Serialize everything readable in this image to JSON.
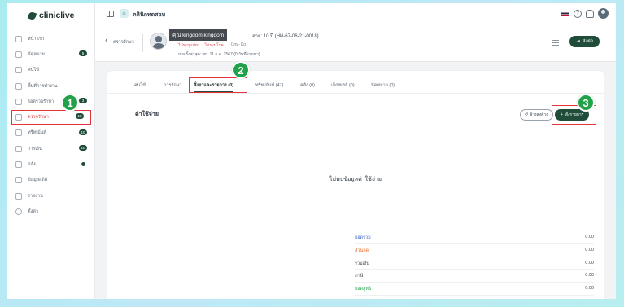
{
  "app": {
    "logo_text": "cliniclive",
    "clinic_name": "คลินิกทดสอบ",
    "accent_color": "#1f4d3a",
    "highlight_color": "#e5343b",
    "marker_color": "#21a24a"
  },
  "sidebar": {
    "items": [
      {
        "label": "หน้าแรก",
        "icon": "home-icon",
        "badge": ""
      },
      {
        "label": "นัดหมาย",
        "icon": "calendar-icon",
        "badge": "5"
      },
      {
        "label": "คนไข้",
        "icon": "patients-icon",
        "badge": ""
      },
      {
        "label": "พื้นที่การทำงาน",
        "icon": "workspace-icon",
        "badge": ""
      },
      {
        "label": "รอตรวจรักษา",
        "icon": "queue-icon",
        "badge": "3"
      },
      {
        "label": "ตรวจรักษา",
        "icon": "stethoscope-icon",
        "badge": "12"
      },
      {
        "label": "ทรีทเม้นท์",
        "icon": "treatment-icon",
        "badge": "10"
      },
      {
        "label": "การเงิน",
        "icon": "finance-icon",
        "badge": "10"
      },
      {
        "label": "คลัง",
        "icon": "inventory-icon",
        "badge": "dot"
      },
      {
        "label": "ข้อมูลสถิติ",
        "icon": "stats-icon",
        "badge": ""
      },
      {
        "label": "รายงาน",
        "icon": "report-icon",
        "badge": ""
      },
      {
        "label": "ตั้งค่า",
        "icon": "settings-icon",
        "badge": ""
      }
    ]
  },
  "patient": {
    "back_label": "ตรวจรักษา",
    "name": "คุณ kingdom kingdom",
    "meta": "อายุ: 10 ปี (HN-67-06-21-0018)",
    "warning_1": "ไม่ระบุแพ้ยา",
    "warning_2": "ไม่ระบุโรค",
    "vitals": "- Cm/- Kg",
    "last_visit": "มาครั้งล่าสุด: พฤ. 11 ก.ค. 2567 (0 วันที่ผ่านมา)",
    "action_button": "ส่งต่อ"
  },
  "tabs": [
    "คนไข้",
    "การรักษา",
    "สั่งยาและรายการ (0)",
    "ทรีทเม้นท์ (47)",
    "คลัง (0)",
    "เอ็กซเรย์ (0)",
    "นัดหมาย (0)"
  ],
  "content": {
    "section_title": "ค่าใช้จ่าย",
    "history_button": "ล้างลงค้าง",
    "order_button": "สั่งรายการ",
    "empty_message": "ไม่พบข้อมูลค่าใช้จ่าย"
  },
  "summary": [
    {
      "label": "ยอดรวม",
      "value": "0.00",
      "color": "#3f66c7"
    },
    {
      "label": "ส่วนลด",
      "value": "0.00",
      "color": "#ef6c2f"
    },
    {
      "label": "รวมเงิน",
      "value": "0.00",
      "color": "#3d4650"
    },
    {
      "label": "ภาษี",
      "value": "0.00",
      "color": "#3d4650"
    },
    {
      "label": "ยอดสุทธิ",
      "value": "0.00",
      "color": "#2fa84f"
    }
  ],
  "markers": [
    "1",
    "2",
    "3"
  ]
}
